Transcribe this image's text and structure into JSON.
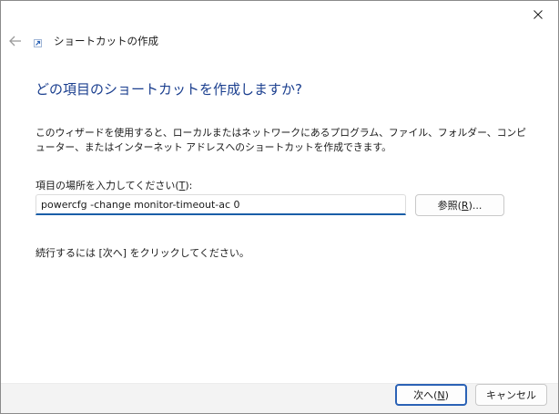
{
  "window": {
    "header_title": "ショートカットの作成",
    "icons": {
      "close": "close-icon",
      "back": "back-arrow-icon",
      "shortcut": "shortcut-arrow-icon"
    }
  },
  "main": {
    "heading": "どの項目のショートカットを作成しますか?",
    "description": "このウィザードを使用すると、ローカルまたはネットワークにあるプログラム、ファイル、フォルダー、コンピューター、またはインターネット アドレスへのショートカットを作成できます。",
    "location_label_prefix": "項目の場所を入力してください(",
    "location_label_key": "T",
    "location_label_suffix": "):",
    "location_value": "powercfg -change monitor-timeout-ac 0",
    "browse_prefix": "参照(",
    "browse_key": "R",
    "browse_suffix": ")...",
    "instruction": "続行するには [次へ] をクリックしてください。"
  },
  "footer": {
    "next_prefix": "次へ(",
    "next_key": "N",
    "next_suffix": ")",
    "cancel_label": "キャンセル"
  },
  "colors": {
    "heading": "#1b3f8f",
    "accent": "#1a5ea8",
    "footer_bg": "#f3f3f3"
  }
}
